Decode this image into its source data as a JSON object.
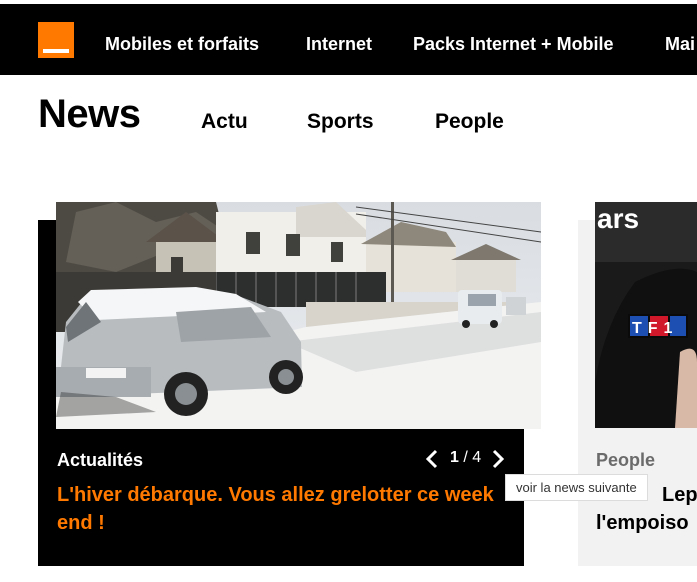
{
  "header": {
    "nav": [
      "Mobiles et forfaits",
      "Internet",
      "Packs Internet + Mobile",
      "Mai"
    ],
    "brand_color": "#ff7900"
  },
  "news": {
    "title": "News",
    "subnav": [
      "Actu",
      "Sports",
      "People"
    ]
  },
  "carousel": {
    "card1": {
      "category": "Actualités",
      "current": "1",
      "separator": "/",
      "total": "4",
      "headline": "L'hiver débarque. Vous allez grelotter ce week end !"
    },
    "tooltip": "voir la news suivante",
    "card2": {
      "category": "People",
      "headline_line1": "Lep",
      "headline_line2": "l'empoiso",
      "logo_text": "TF1",
      "sign_text": "ars"
    }
  }
}
